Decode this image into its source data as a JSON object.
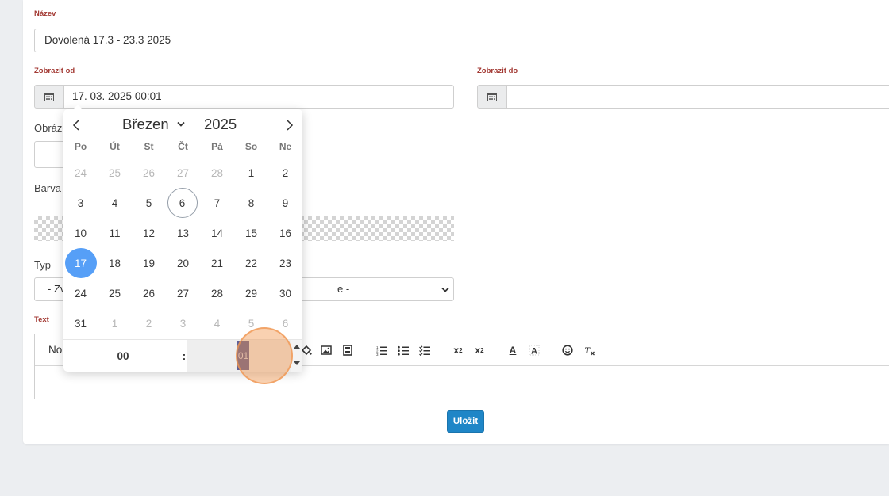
{
  "form": {
    "name_label": "Název",
    "name_value": "Dovolená 17.3 - 23.3 2025",
    "from_label": "Zobrazit od",
    "from_value": "17. 03. 2025 00:01",
    "to_label": "Zobrazit do",
    "to_value": "",
    "image_label": "Obrázek",
    "color_label": "Barva",
    "type_label": "Typ",
    "type_value_left": "- Zv",
    "type_value_right": "e -",
    "text_label": "Text",
    "editor_format": "No",
    "save_label": "Uložit"
  },
  "datepicker": {
    "month": "Březen",
    "year": "2025",
    "weekdays": [
      "Po",
      "Út",
      "St",
      "Čt",
      "Pá",
      "So",
      "Ne"
    ],
    "weeks": [
      [
        "24",
        "25",
        "26",
        "27",
        "28",
        "1",
        "2"
      ],
      [
        "3",
        "4",
        "5",
        "6",
        "7",
        "8",
        "9"
      ],
      [
        "10",
        "11",
        "12",
        "13",
        "14",
        "15",
        "16"
      ],
      [
        "17",
        "18",
        "19",
        "20",
        "21",
        "22",
        "23"
      ],
      [
        "24",
        "25",
        "26",
        "27",
        "28",
        "29",
        "30"
      ],
      [
        "31",
        "1",
        "2",
        "3",
        "4",
        "5",
        "6"
      ]
    ],
    "today": "6",
    "selected": "17",
    "hour": "00",
    "separator": ":",
    "minute": "01"
  },
  "toolbar_icons": [
    "paint-bucket-icon",
    "image-icon",
    "film-icon",
    "numbered-list-icon",
    "bullet-list-icon",
    "checklist-icon",
    "subscript-icon",
    "superscript-icon",
    "text-color-icon",
    "background-color-icon",
    "emoji-icon",
    "remove-format-icon"
  ],
  "colors": {
    "accent": "#1f86c7",
    "selected_day": "#569ff7",
    "label_red": "#a33a34"
  }
}
